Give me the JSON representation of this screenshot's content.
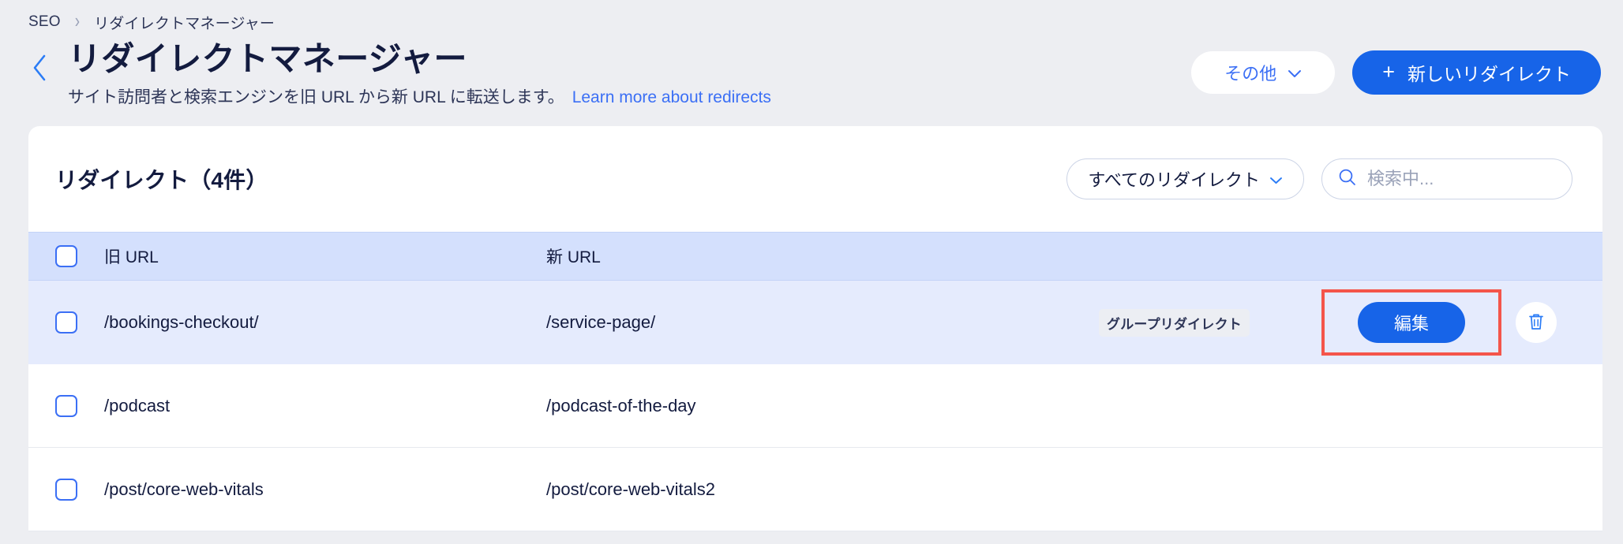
{
  "breadcrumb": {
    "items": [
      "SEO",
      "リダイレクトマネージャー"
    ],
    "separator": "›"
  },
  "header": {
    "back_icon": "chevron-left-icon",
    "title": "リダイレクトマネージャー",
    "subtitle": "サイト訪問者と検索エンジンを旧 URL から新 URL に転送します。",
    "learn_more_label": "Learn more about redirects",
    "secondary_button": {
      "label": "その他",
      "icon": "chevron-down-icon"
    },
    "primary_button": {
      "icon": "plus-icon",
      "label": "新しいリダイレクト"
    }
  },
  "card": {
    "title": "リダイレクト（4件）",
    "filter": {
      "label": "すべてのリダイレクト",
      "icon": "chevron-down-icon"
    },
    "search": {
      "icon": "search-icon",
      "value": "",
      "placeholder": "検索中..."
    },
    "table": {
      "columns": [
        "旧 URL",
        "新 URL"
      ],
      "rows": [
        {
          "old_url": "/bookings-checkout/",
          "new_url": "/service-page/",
          "tag": "グループリダイレクト",
          "selected": true,
          "edit_label": "編集",
          "delete_icon": "trash-icon",
          "highlighted": true
        },
        {
          "old_url": "/podcast",
          "new_url": "/podcast-of-the-day",
          "tag": "",
          "selected": false
        },
        {
          "old_url": "/post/core-web-vitals",
          "new_url": "/post/core-web-vitals2",
          "tag": "",
          "selected": false
        }
      ]
    }
  },
  "colors": {
    "page_background": "#edeef2",
    "accent_blue": "#1764e8",
    "link_blue": "#3b6ff5",
    "header_row": "#d4e0fd",
    "selected_row": "#e5ebfd",
    "highlight_outline": "#f4554a",
    "text_dark": "#131b3f"
  }
}
